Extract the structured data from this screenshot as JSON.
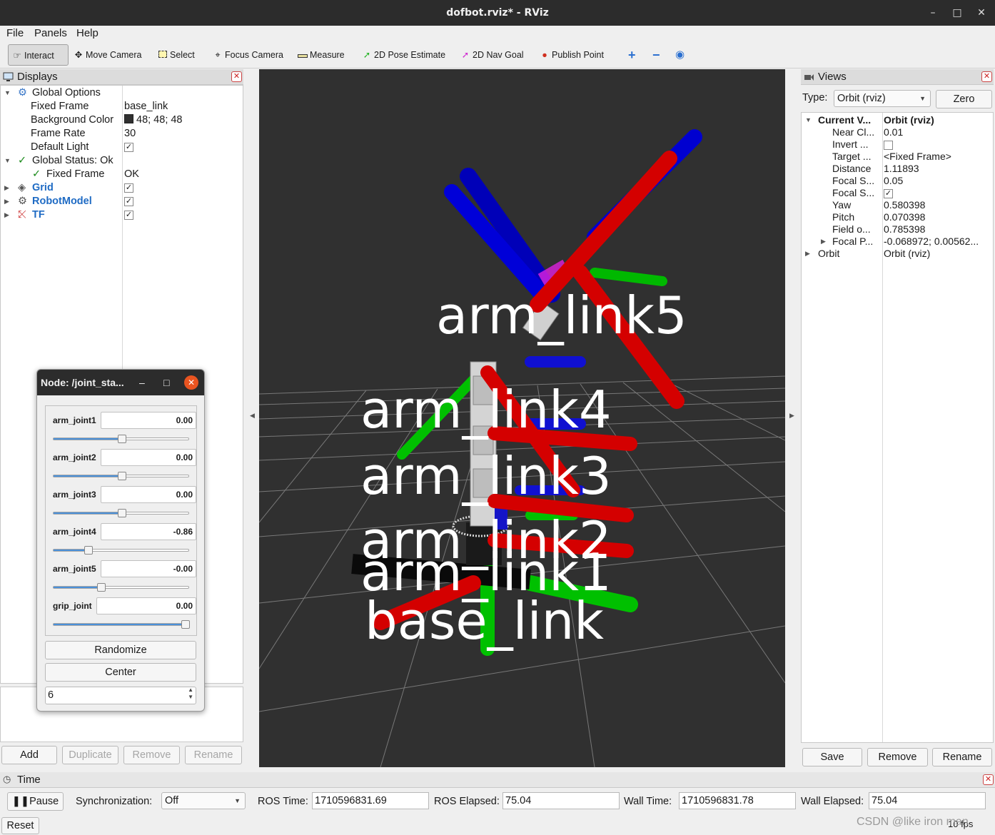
{
  "window": {
    "title": "dofbot.rviz* - RViz"
  },
  "menu": [
    "File",
    "Panels",
    "Help"
  ],
  "toolbar": {
    "tools": [
      "Interact",
      "Move Camera",
      "Select",
      "Focus Camera",
      "Measure",
      "2D Pose Estimate",
      "2D Nav Goal",
      "Publish Point"
    ],
    "active": "Interact"
  },
  "displays": {
    "title": "Displays",
    "rows": [
      {
        "key": "Global Options",
        "value": ""
      },
      {
        "key": "Fixed Frame",
        "value": "base_link"
      },
      {
        "key": "Background Color",
        "value": "48; 48; 48"
      },
      {
        "key": "Frame Rate",
        "value": "30"
      },
      {
        "key": "Default Light",
        "value": ""
      },
      {
        "key": "Global Status: Ok",
        "value": ""
      },
      {
        "key": "Fixed Frame",
        "value": "OK"
      },
      {
        "key": "Grid",
        "value": ""
      },
      {
        "key": "RobotModel",
        "value": ""
      },
      {
        "key": "TF",
        "value": ""
      }
    ],
    "background_color": "#303030",
    "buttons": [
      "Add",
      "Duplicate",
      "Remove",
      "Rename"
    ]
  },
  "scene": {
    "frame_labels": [
      "arm_link5",
      "arm_link4",
      "arm_link3",
      "arm_link2",
      "arm_link1",
      "base_link"
    ],
    "axis_colors": {
      "x": "#d40000",
      "y": "#00c800",
      "z": "#0000d8"
    }
  },
  "views": {
    "title": "Views",
    "type_label": "Type:",
    "type_value": "Orbit (rviz)",
    "zero_label": "Zero",
    "rows": [
      {
        "key": "Current V...",
        "value": "Orbit (rviz)"
      },
      {
        "key": "Near Cl...",
        "value": "0.01"
      },
      {
        "key": "Invert ...",
        "value": ""
      },
      {
        "key": "Target ...",
        "value": "<Fixed Frame>"
      },
      {
        "key": "Distance",
        "value": "1.11893"
      },
      {
        "key": "Focal S...",
        "value": "0.05"
      },
      {
        "key": "Focal S...",
        "value": ""
      },
      {
        "key": "Yaw",
        "value": "0.580398"
      },
      {
        "key": "Pitch",
        "value": "0.070398"
      },
      {
        "key": "Field o...",
        "value": "0.785398"
      },
      {
        "key": "Focal P...",
        "value": "-0.068972; 0.00562..."
      },
      {
        "key": "Orbit",
        "value": "Orbit (rviz)"
      }
    ],
    "buttons": [
      "Save",
      "Remove",
      "Rename"
    ]
  },
  "time": {
    "title": "Time",
    "pause_label": "Pause",
    "sync_label": "Synchronization:",
    "sync_value": "Off",
    "ros_time_label": "ROS Time:",
    "ros_time": "1710596831.69",
    "ros_elapsed_label": "ROS Elapsed:",
    "ros_elapsed": "75.04",
    "wall_time_label": "Wall Time:",
    "wall_time": "1710596831.78",
    "wall_elapsed_label": "Wall Elapsed:",
    "wall_elapsed": "75.04",
    "reset_label": "Reset",
    "fps": "10 fps"
  },
  "joint_dialog": {
    "title": "Node: /joint_sta...",
    "joints": [
      {
        "name": "arm_joint1",
        "value": "0.00",
        "fraction": 0.5
      },
      {
        "name": "arm_joint2",
        "value": "0.00",
        "fraction": 0.5
      },
      {
        "name": "arm_joint3",
        "value": "0.00",
        "fraction": 0.5
      },
      {
        "name": "arm_joint4",
        "value": "-0.86",
        "fraction": 0.24
      },
      {
        "name": "arm_joint5",
        "value": "-0.00",
        "fraction": 0.34
      },
      {
        "name": "grip_joint",
        "value": "0.00",
        "fraction": 1.0
      }
    ],
    "randomize_label": "Randomize",
    "center_label": "Center",
    "spin_value": "6"
  },
  "watermark": "CSDN @like iron man"
}
